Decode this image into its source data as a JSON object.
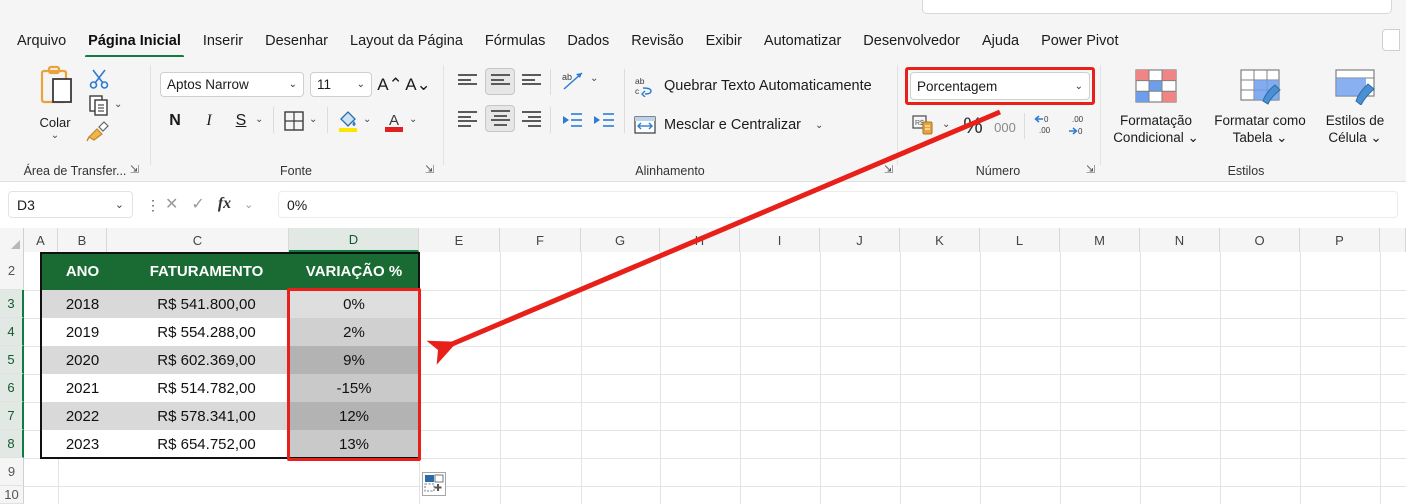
{
  "app": {
    "search_placeholder": ""
  },
  "ribbon": {
    "tabs": [
      {
        "label": "Arquivo",
        "active": false
      },
      {
        "label": "Página Inicial",
        "active": true
      },
      {
        "label": "Inserir",
        "active": false
      },
      {
        "label": "Desenhar",
        "active": false
      },
      {
        "label": "Layout da Página",
        "active": false
      },
      {
        "label": "Fórmulas",
        "active": false
      },
      {
        "label": "Dados",
        "active": false
      },
      {
        "label": "Revisão",
        "active": false
      },
      {
        "label": "Exibir",
        "active": false
      },
      {
        "label": "Automatizar",
        "active": false
      },
      {
        "label": "Desenvolvedor",
        "active": false
      },
      {
        "label": "Ajuda",
        "active": false
      },
      {
        "label": "Power Pivot",
        "active": false
      }
    ],
    "groups": {
      "clipboard": {
        "label": "Área de Transfer...",
        "paste_label": "Colar",
        "cut_icon": "scissors-icon",
        "copy_icon": "copy-icon",
        "format_painter_icon": "format-painter-icon"
      },
      "font": {
        "label": "Fonte",
        "font_family": "Aptos Narrow",
        "font_size": "11",
        "grow_font": "A⌃",
        "shrink_font": "A⌄",
        "bold": "N",
        "italic": "I",
        "underline": "S",
        "borders_icon": "borders-icon",
        "fill_color_icon": "fill-color-icon",
        "font_color_icon": "font-color-icon"
      },
      "alignment": {
        "label": "Alinhamento",
        "wrap_text": "Quebrar Texto Automaticamente",
        "merge_center": "Mesclar e Centralizar",
        "orientation_icon": "text-orientation-icon",
        "decrease_indent_icon": "decrease-indent-icon",
        "increase_indent_icon": "increase-indent-icon"
      },
      "number": {
        "label": "Número",
        "format_value": "Porcentagem",
        "accounting_icon": "accounting-format-icon",
        "percent_style": "%",
        "comma_style": "000",
        "decrease_decimal_icon": "decrease-decimal-icon",
        "increase_decimal_icon": "increase-decimal-icon",
        "highlight_color": "#e8201a"
      },
      "styles": {
        "label": "Estilos",
        "items": [
          {
            "line1": "Formatação",
            "line2": "Condicional ⌄",
            "icon": "conditional-formatting-icon"
          },
          {
            "line1": "Formatar como",
            "line2": "Tabela ⌄",
            "icon": "format-as-table-icon"
          },
          {
            "line1": "Estilos de",
            "line2": "Célula ⌄",
            "icon": "cell-styles-icon"
          }
        ]
      }
    }
  },
  "formula_bar": {
    "name_box": "D3",
    "cancel_icon": "close-icon",
    "confirm_icon": "check-icon",
    "fx_icon": "fx-icon",
    "content": "0%"
  },
  "grid": {
    "columns": [
      "A",
      "B",
      "C",
      "D",
      "E",
      "F",
      "G",
      "H",
      "I",
      "J",
      "K",
      "L",
      "M",
      "N",
      "O",
      "P"
    ],
    "selected_column": "D",
    "rows": [
      "2",
      "3",
      "4",
      "5",
      "6",
      "7",
      "8",
      "9",
      "10"
    ],
    "selected_rows": [
      "3",
      "4",
      "5",
      "6",
      "7",
      "8"
    ]
  },
  "table": {
    "headers": [
      "ANO",
      "FATURAMENTO",
      "VARIAÇÃO %"
    ],
    "header_bg": "#1a6b33",
    "header_color": "#ffffff",
    "rows": [
      {
        "ano": "2018",
        "faturamento": "R$ 541.800,00",
        "variacao": "0%"
      },
      {
        "ano": "2019",
        "faturamento": "R$ 554.288,00",
        "variacao": "2%"
      },
      {
        "ano": "2020",
        "faturamento": "R$ 602.369,00",
        "variacao": "9%"
      },
      {
        "ano": "2021",
        "faturamento": "R$ 514.782,00",
        "variacao": "-15%"
      },
      {
        "ano": "2022",
        "faturamento": "R$ 578.341,00",
        "variacao": "12%"
      },
      {
        "ano": "2023",
        "faturamento": "R$ 654.752,00",
        "variacao": "13%"
      }
    ]
  },
  "annotation": {
    "arrow_color": "#e8201a",
    "from_label": "Porcentagem",
    "to_label": "VARIAÇÃO % column"
  },
  "quick_analysis": {
    "icon": "quick-analysis-icon"
  }
}
